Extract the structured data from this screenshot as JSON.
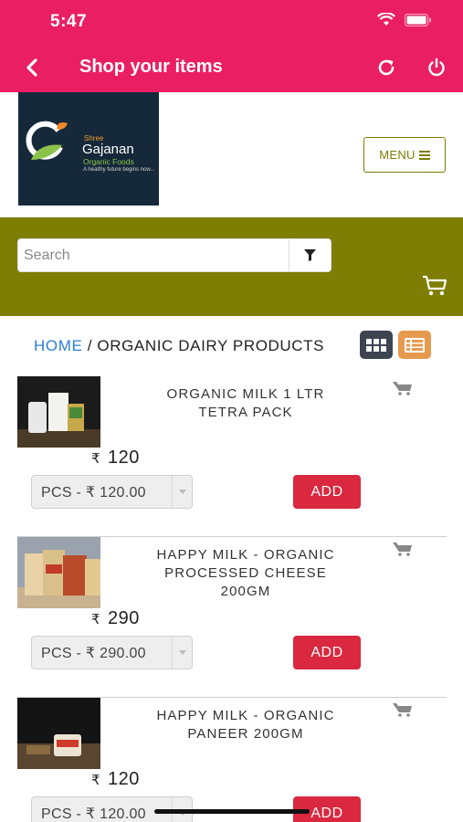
{
  "status": {
    "time": "5:47"
  },
  "appbar": {
    "title": "Shop your items"
  },
  "logo": {
    "shree": "Shree",
    "name": "Gajanan",
    "sub": "Organic Foods",
    "tagline": "A healthy future begins now..."
  },
  "menu": {
    "label": "MENU"
  },
  "search": {
    "placeholder": "Search"
  },
  "breadcrumb": {
    "home": "HOME",
    "separator": " / ",
    "current": "ORGANIC DAIRY PRODUCTS"
  },
  "products": [
    {
      "name_line1": "ORGANIC MILK 1 LTR",
      "name_line2": "TETRA PACK",
      "name_line3": "",
      "currency": "₹",
      "price": "120",
      "variant": "PCS - ₹ 120.00",
      "add_label": "ADD"
    },
    {
      "name_line1": "HAPPY MILK - ORGANIC",
      "name_line2": "PROCESSED CHEESE",
      "name_line3": "200GM",
      "currency": "₹",
      "price": "290",
      "variant": "PCS - ₹ 290.00",
      "add_label": "ADD"
    },
    {
      "name_line1": "HAPPY MILK - ORGANIC",
      "name_line2": "PANEER 200GM",
      "name_line3": "",
      "currency": "₹",
      "price": "120",
      "variant": "PCS - ₹ 120.00",
      "add_label": "ADD"
    }
  ],
  "colors": {
    "primary": "#ea1f63",
    "olive": "#7e7e05",
    "add": "#d9283f",
    "home_link": "#2a7fd4"
  }
}
